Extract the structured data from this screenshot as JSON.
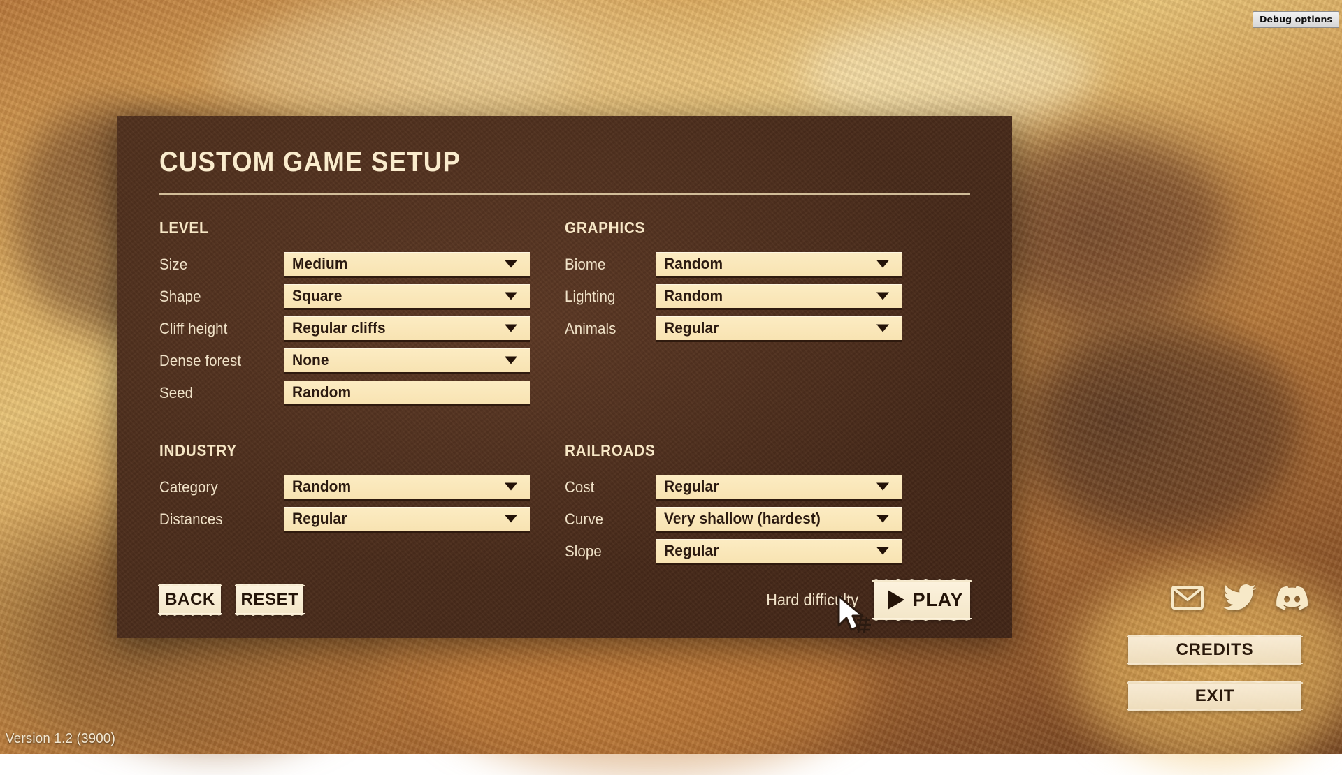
{
  "debug": {
    "label": "Debug options"
  },
  "panel": {
    "title": "CUSTOM GAME SETUP",
    "sections": {
      "level": {
        "heading": "LEVEL",
        "rows": [
          {
            "label": "Size",
            "value": "Medium",
            "control": "dropdown"
          },
          {
            "label": "Shape",
            "value": "Square",
            "control": "dropdown"
          },
          {
            "label": "Cliff height",
            "value": "Regular cliffs",
            "control": "dropdown"
          },
          {
            "label": "Dense forest",
            "value": "None",
            "control": "dropdown"
          },
          {
            "label": "Seed",
            "value": "Random",
            "control": "textinput"
          }
        ]
      },
      "graphics": {
        "heading": "GRAPHICS",
        "rows": [
          {
            "label": "Biome",
            "value": "Random",
            "control": "dropdown"
          },
          {
            "label": "Lighting",
            "value": "Random",
            "control": "dropdown"
          },
          {
            "label": "Animals",
            "value": "Regular",
            "control": "dropdown"
          }
        ]
      },
      "industry": {
        "heading": "INDUSTRY",
        "rows": [
          {
            "label": "Category",
            "value": "Random",
            "control": "dropdown"
          },
          {
            "label": "Distances",
            "value": "Regular",
            "control": "dropdown"
          }
        ]
      },
      "railroads": {
        "heading": "RAILROADS",
        "rows": [
          {
            "label": "Cost",
            "value": "Regular",
            "control": "dropdown"
          },
          {
            "label": "Curve",
            "value": "Very shallow (hardest)",
            "control": "dropdown"
          },
          {
            "label": "Slope",
            "value": "Regular",
            "control": "dropdown"
          }
        ]
      }
    },
    "footer": {
      "back_label": "BACK",
      "reset_label": "RESET",
      "difficulty_label": "Hard difficulty",
      "play_label": "PLAY",
      "play_icon": "play-triangle-icon"
    }
  },
  "social": [
    {
      "name": "mail-icon",
      "title": "Mail"
    },
    {
      "name": "twitter-icon",
      "title": "Twitter"
    },
    {
      "name": "discord-icon",
      "title": "Discord"
    }
  ],
  "side_menu": [
    {
      "label": "CREDITS"
    },
    {
      "label": "EXIT"
    }
  ],
  "version": "Version 1.2 (3900)",
  "colors": {
    "panel_bg": "#4a2c1c",
    "field_bg": "#fbe9bd",
    "field_text": "#2b1a10",
    "label_text": "#f0e2c8",
    "accent_rule": "#e9d6ae",
    "button_paper": "#f7ead0"
  }
}
